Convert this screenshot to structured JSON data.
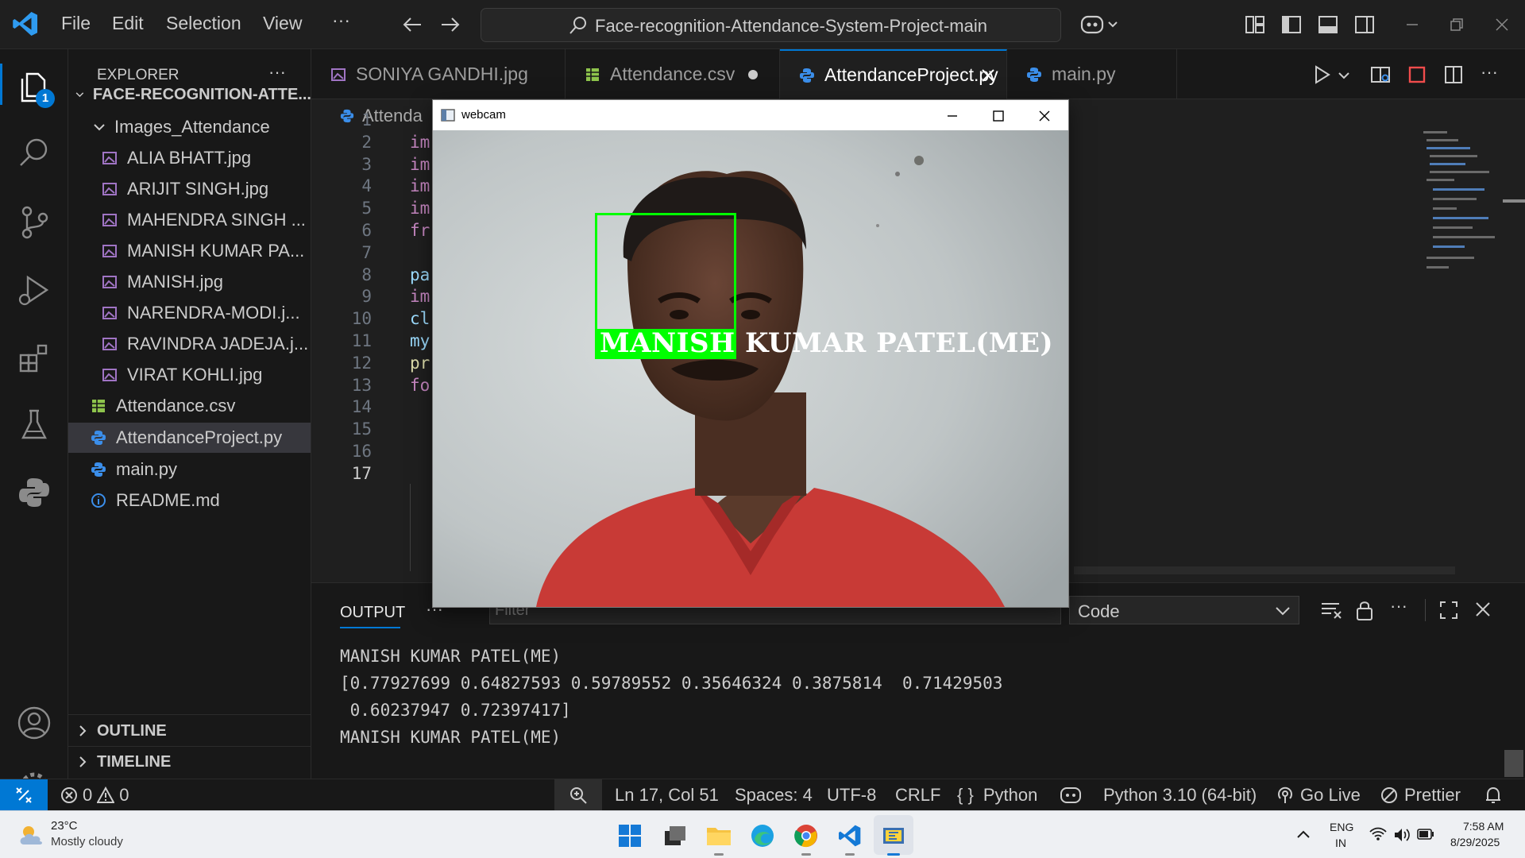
{
  "menu": {
    "file": "File",
    "edit": "Edit",
    "selection": "Selection",
    "view": "View",
    "more": "···"
  },
  "search": {
    "text": "Face-recognition-Attendance-System-Project-main"
  },
  "activity": {
    "explorer_badge": "1"
  },
  "sidebar": {
    "title": "EXPLORER",
    "more": "···",
    "root": "FACE-RECOGNITION-ATTE...",
    "folder": "Images_Attendance",
    "images": [
      "ALIA BHATT.jpg",
      "ARIJIT SINGH.jpg",
      "MAHENDRA SINGH ...",
      "MANISH KUMAR PA...",
      "MANISH.jpg",
      "NARENDRA-MODI.j...",
      "RAVINDRA JADEJA.j...",
      "VIRAT KOHLI.jpg"
    ],
    "files": [
      "Attendance.csv",
      "AttendanceProject.py",
      "main.py",
      "README.md"
    ],
    "outline": "OUTLINE",
    "timeline": "TIMELINE"
  },
  "tabs": [
    {
      "label": "SONIYA GANDHI.jpg"
    },
    {
      "label": "Attendance.csv"
    },
    {
      "label": "AttendanceProject.py"
    },
    {
      "label": "main.py"
    }
  ],
  "editor": {
    "breadcrumb": "Attenda",
    "line_numbers": [
      "1",
      "2",
      "3",
      "4",
      "5",
      "6",
      "7",
      "8",
      "9",
      "10",
      "11",
      "12",
      "13",
      "14",
      "15",
      "16",
      "17"
    ],
    "code": [
      "",
      "im",
      "im",
      "im",
      "im",
      "fr",
      "",
      "pa",
      "im",
      "cl",
      "my",
      "pr",
      "fo",
      "",
      "",
      "",
      ""
    ]
  },
  "panel": {
    "tab": "OUTPUT",
    "more": "···",
    "filter_placeholder": "Filter",
    "channel": "Code",
    "lines": [
      "MANISH KUMAR PATEL(ME)",
      "[0.77927699 0.64827593 0.59789552 0.35646324 0.3875814  0.71429503",
      " 0.60237947 0.72397417]",
      "MANISH KUMAR PATEL(ME)"
    ]
  },
  "webcam": {
    "title": "webcam",
    "label": "MANISH KUMAR PATEL(ME)"
  },
  "status": {
    "errors": "0",
    "warnings": "0",
    "position": "Ln 17, Col 51",
    "spaces": "Spaces: 4",
    "encoding": "UTF-8",
    "eol": "CRLF",
    "language": "Python",
    "interpreter": "Python 3.10 (64-bit)",
    "golive": "Go Live",
    "prettier": "Prettier"
  },
  "taskbar": {
    "temp": "23°C",
    "weather": "Mostly cloudy",
    "lang1": "ENG",
    "lang2": "IN",
    "time": "7:58 AM",
    "date": "8/29/2025"
  },
  "colors": {
    "accent": "#0078d4",
    "face_box": "#00ff00",
    "python": "#3b8eea",
    "csv": "#8ec44c"
  }
}
